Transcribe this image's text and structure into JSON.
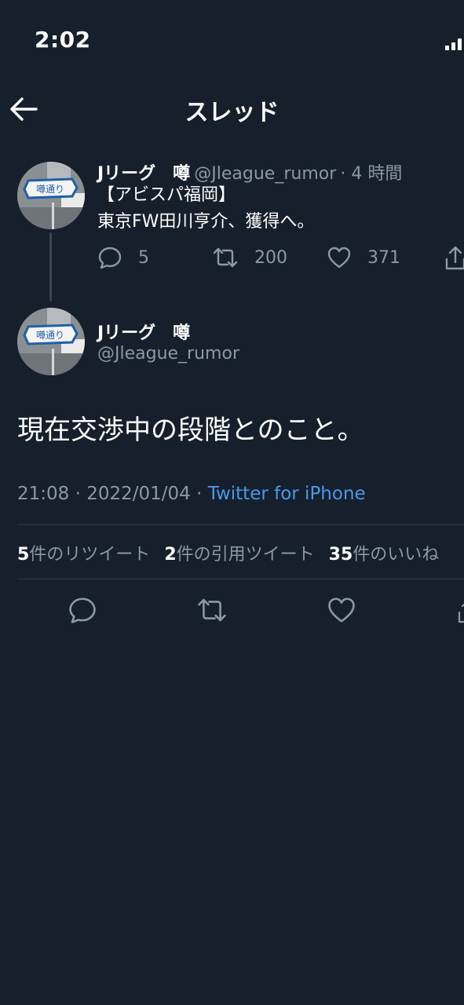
{
  "status_bar": {
    "time": "2:02"
  },
  "header": {
    "title": "スレッド"
  },
  "tweet1": {
    "name": "Jリーグ　噂",
    "handle": "@Jleague_rumor",
    "time_ago": "· 4 時間",
    "lines": [
      "【アビスパ福岡】",
      "東京FW田川亨介、獲得へ。"
    ],
    "replies": "5",
    "retweets": "200",
    "likes": "371"
  },
  "tweet2": {
    "name": "Jリーグ　噂",
    "handle": "@Jleague_rumor",
    "text": "現在交渉中の段階とのこと。",
    "timestamp": "21:08 · 2022/01/04 · ",
    "source": "Twitter for iPhone",
    "stats": [
      {
        "count": "5",
        "label": "件のリツイート"
      },
      {
        "count": "2",
        "label": "件の引用ツイート"
      },
      {
        "count": "35",
        "label": "件のいいね"
      }
    ],
    "avatar_sign": "噂通り"
  },
  "colors": {
    "background": "#16202c",
    "muted": "#8b98a5",
    "link": "#4a99e9"
  },
  "icons": [
    "back-arrow-icon",
    "reply-icon",
    "retweet-icon",
    "like-icon",
    "share-icon",
    "signal-icon"
  ]
}
